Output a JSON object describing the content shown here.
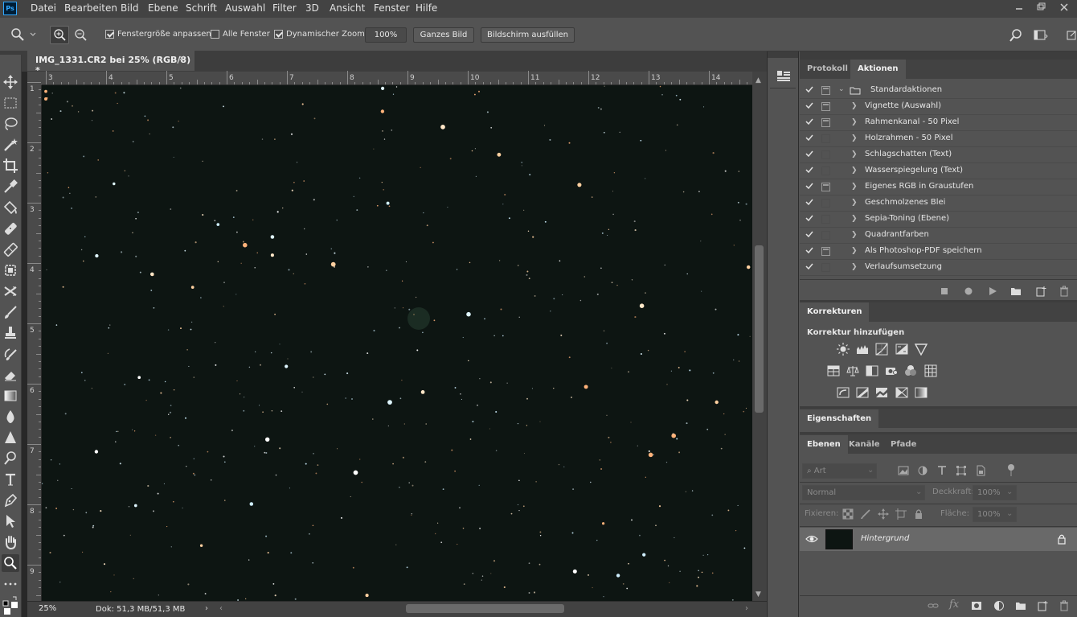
{
  "app": {
    "logo": "Ps"
  },
  "menu": [
    "Datei",
    "Bearbeiten",
    "Bild",
    "Ebene",
    "Schrift",
    "Auswahl",
    "Filter",
    "3D",
    "Ansicht",
    "Fenster",
    "Hilfe"
  ],
  "options": {
    "fit_window_label": "Fenstergröße anpassen",
    "all_windows_label": "Alle Fenster",
    "dynamic_zoom_label": "Dynamischer Zoom",
    "zoom_value": "100%",
    "fit_screen_button": "Ganzes Bild",
    "fill_screen_button": "Bildschirm ausfüllen"
  },
  "document": {
    "tab_title": "IMG_1331.CR2 bei 25% (RGB/8) *",
    "zoom": "25%",
    "doc_size": "Dok: 51,3 MB/51,3 MB",
    "ruler_top": [
      "3",
      "4",
      "5",
      "6",
      "7",
      "8",
      "9",
      "10",
      "11",
      "12",
      "13",
      "14"
    ],
    "ruler_left": [
      "1",
      "2",
      "3",
      "4",
      "5",
      "6",
      "7",
      "8",
      "9"
    ]
  },
  "actions_panel": {
    "tabs": [
      "Protokoll",
      "Aktionen"
    ],
    "active_tab": "Aktionen",
    "set_name": "Standardaktionen",
    "items": [
      {
        "label": "Vignette (Auswahl)",
        "dialog": true
      },
      {
        "label": "Rahmenkanal - 50 Pixel",
        "dialog": true
      },
      {
        "label": "Holzrahmen - 50 Pixel",
        "dialog": false
      },
      {
        "label": "Schlagschatten (Text)",
        "dialog": false
      },
      {
        "label": "Wasserspiegelung (Text)",
        "dialog": false
      },
      {
        "label": "Eigenes RGB in Graustufen",
        "dialog": true
      },
      {
        "label": "Geschmolzenes Blei",
        "dialog": false
      },
      {
        "label": "Sepia-Toning (Ebene)",
        "dialog": false
      },
      {
        "label": "Quadrantfarben",
        "dialog": false
      },
      {
        "label": "Als Photoshop-PDF speichern",
        "dialog": true
      },
      {
        "label": "Verlaufsumsetzung",
        "dialog": false
      }
    ]
  },
  "adjustments_panel": {
    "tab": "Korrekturen",
    "heading": "Korrektur hinzufügen"
  },
  "properties_panel": {
    "tab": "Eigenschaften"
  },
  "layers_panel": {
    "tabs": [
      "Ebenen",
      "Kanäle",
      "Pfade"
    ],
    "active_tab": "Ebenen",
    "filter_placeholder": "Art",
    "blend_mode": "Normal",
    "opacity_label": "Deckkraft:",
    "opacity_value": "100%",
    "lock_label": "Fixieren:",
    "fill_label": "Fläche:",
    "fill_value": "100%",
    "layer_name": "Hintergrund"
  },
  "colors": {
    "accent": "#31a8ff",
    "ui_bg": "#535353",
    "canvas_bg": "#0d1512"
  }
}
